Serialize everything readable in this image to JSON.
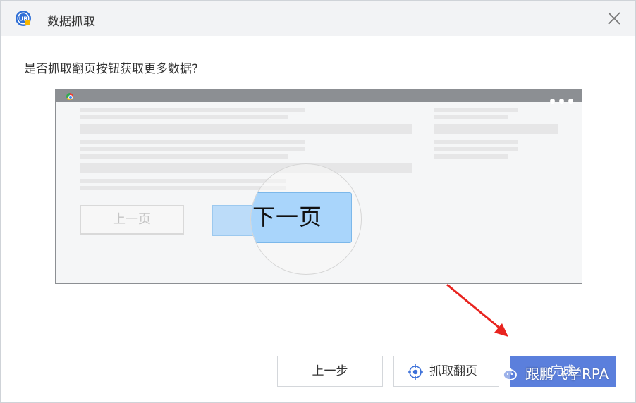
{
  "dialog": {
    "title": "数据抓取",
    "logo_icon": "uibot-logo-icon",
    "close_icon": "close-icon"
  },
  "question": "是否抓取翻页按钮获取更多数据?",
  "preview": {
    "prev_page_label": "上一页",
    "next_page_label": "下一页",
    "browser_icon": "browser-icon",
    "menu_icon": "more-dots-icon"
  },
  "buttons": {
    "prev_step": "上一步",
    "capture_page": "抓取翻页",
    "capture_icon": "crosshair-target-icon",
    "finish": "完成"
  },
  "annotation": {
    "arrow_color": "#e8241f"
  },
  "watermark": {
    "text": "跟鹏飞学RPA",
    "icon": "wechat-icon"
  },
  "colors": {
    "primary": "#5b7fdc",
    "highlight": "#a9d5fb"
  }
}
